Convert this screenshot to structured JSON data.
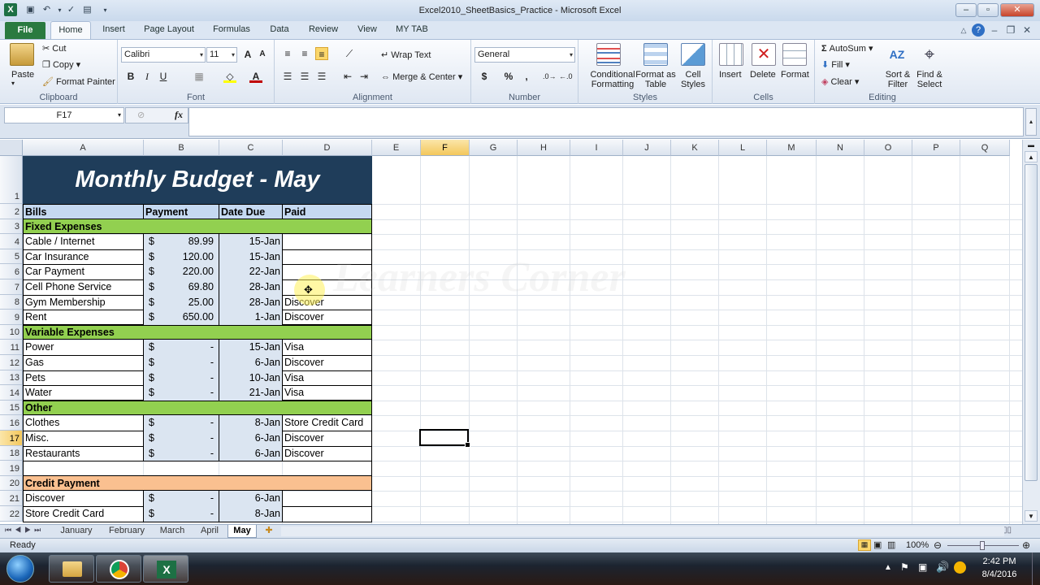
{
  "window": {
    "title": "Excel2010_SheetBasics_Practice - Microsoft Excel"
  },
  "ribbon_tabs": [
    "File",
    "Home",
    "Insert",
    "Page Layout",
    "Formulas",
    "Data",
    "Review",
    "View",
    "MY TAB"
  ],
  "clipboard": {
    "paste": "Paste",
    "cut": "Cut",
    "copy": "Copy",
    "format_painter": "Format Painter",
    "label": "Clipboard"
  },
  "font": {
    "name": "Calibri",
    "size": "11",
    "bold": "B",
    "italic": "I",
    "underline": "U",
    "label": "Font"
  },
  "alignment": {
    "wrap": "Wrap Text",
    "merge": "Merge & Center",
    "label": "Alignment"
  },
  "number": {
    "format": "General",
    "currency": "$",
    "percent": "%",
    "comma": ",",
    "label": "Number"
  },
  "styles": {
    "conditional": "Conditional Formatting",
    "format_table": "Format as Table",
    "cell_styles": "Cell Styles",
    "label": "Styles"
  },
  "cells": {
    "insert": "Insert",
    "delete": "Delete",
    "format": "Format",
    "label": "Cells"
  },
  "editing": {
    "autosum": "AutoSum",
    "fill": "Fill",
    "clear": "Clear",
    "sort": "Sort & Filter",
    "find": "Find & Select",
    "label": "Editing"
  },
  "formula_bar": {
    "name_box": "F17",
    "fx": "fx",
    "value": ""
  },
  "columns": [
    "A",
    "B",
    "C",
    "D",
    "E",
    "F",
    "G",
    "H",
    "I",
    "J",
    "K",
    "L",
    "M",
    "N",
    "O",
    "P",
    "Q"
  ],
  "sheet": {
    "title": "Monthly Budget - May",
    "headers": [
      "Bills",
      "Payment",
      "Date Due",
      "Paid"
    ],
    "sections": {
      "fixed": "Fixed Expenses",
      "variable": "Variable Expenses",
      "other": "Other",
      "credit": "Credit Payment"
    },
    "rows": [
      {
        "r": "4",
        "a": "Cable / Internet",
        "cur": "$",
        "b": "89.99",
        "c": "15-Jan",
        "d": ""
      },
      {
        "r": "5",
        "a": "Car Insurance",
        "cur": "$",
        "b": "120.00",
        "c": "15-Jan",
        "d": ""
      },
      {
        "r": "6",
        "a": "Car Payment",
        "cur": "$",
        "b": "220.00",
        "c": "22-Jan",
        "d": ""
      },
      {
        "r": "7",
        "a": "Cell Phone Service",
        "cur": "$",
        "b": "69.80",
        "c": "28-Jan",
        "d": ""
      },
      {
        "r": "8",
        "a": "Gym Membership",
        "cur": "$",
        "b": "25.00",
        "c": "28-Jan",
        "d": "Discover"
      },
      {
        "r": "9",
        "a": "Rent",
        "cur": "$",
        "b": "650.00",
        "c": "1-Jan",
        "d": "Discover"
      },
      {
        "r": "11",
        "a": "Power",
        "cur": "$",
        "b": "-",
        "c": "15-Jan",
        "d": "Visa"
      },
      {
        "r": "12",
        "a": "Gas",
        "cur": "$",
        "b": "-",
        "c": "6-Jan",
        "d": "Discover"
      },
      {
        "r": "13",
        "a": "Pets",
        "cur": "$",
        "b": "-",
        "c": "10-Jan",
        "d": "Visa"
      },
      {
        "r": "14",
        "a": "Water",
        "cur": "$",
        "b": "-",
        "c": "21-Jan",
        "d": "Visa"
      },
      {
        "r": "16",
        "a": "Clothes",
        "cur": "$",
        "b": "-",
        "c": "8-Jan",
        "d": "Store Credit Card"
      },
      {
        "r": "17",
        "a": "Misc.",
        "cur": "$",
        "b": "-",
        "c": "6-Jan",
        "d": "Discover"
      },
      {
        "r": "18",
        "a": "Restaurants",
        "cur": "$",
        "b": "-",
        "c": "6-Jan",
        "d": "Discover"
      },
      {
        "r": "21",
        "a": "Discover",
        "cur": "$",
        "b": "-",
        "c": "6-Jan",
        "d": ""
      },
      {
        "r": "22",
        "a": "Store Credit Card",
        "cur": "$",
        "b": "-",
        "c": "8-Jan",
        "d": ""
      }
    ]
  },
  "row_numbers": [
    "1",
    "2",
    "3",
    "4",
    "5",
    "6",
    "7",
    "8",
    "9",
    "10",
    "11",
    "12",
    "13",
    "14",
    "15",
    "16",
    "17",
    "18",
    "19",
    "20",
    "21",
    "22"
  ],
  "watermark": "Learners Corner",
  "sheet_tabs": [
    "January",
    "February",
    "March",
    "April",
    "May"
  ],
  "status": {
    "ready": "Ready",
    "zoom": "100%"
  },
  "taskbar": {
    "time": "2:42 PM",
    "date": "8/4/2016"
  },
  "colors": {
    "title_bg": "#1f3d5a",
    "header_bg": "#c5d9f1",
    "section_green": "#92d050",
    "section_orange": "#fac090"
  }
}
